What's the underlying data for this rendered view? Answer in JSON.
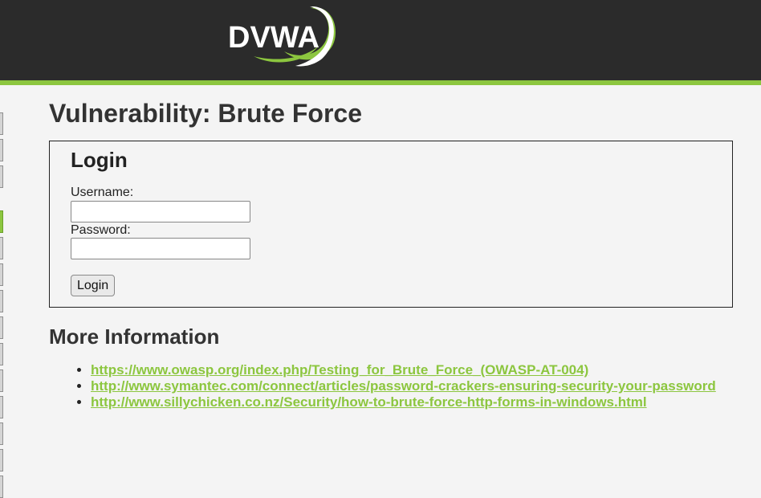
{
  "header": {
    "logo_text": "DVWA"
  },
  "colors": {
    "accent": "#8cc63f",
    "header_bg": "#2b2b2b",
    "page_bg": "#f4f4f4"
  },
  "sidebar": {
    "active_index": 4,
    "tab_count": 14
  },
  "page": {
    "title": "Vulnerability: Brute Force"
  },
  "login": {
    "heading": "Login",
    "username_label": "Username:",
    "username_value": "",
    "password_label": "Password:",
    "password_value": "",
    "button_label": "Login"
  },
  "more_info": {
    "heading": "More Information",
    "links": [
      "https://www.owasp.org/index.php/Testing_for_Brute_Force_(OWASP-AT-004)",
      "http://www.symantec.com/connect/articles/password-crackers-ensuring-security-your-password",
      "http://www.sillychicken.co.nz/Security/how-to-brute-force-http-forms-in-windows.html"
    ]
  }
}
